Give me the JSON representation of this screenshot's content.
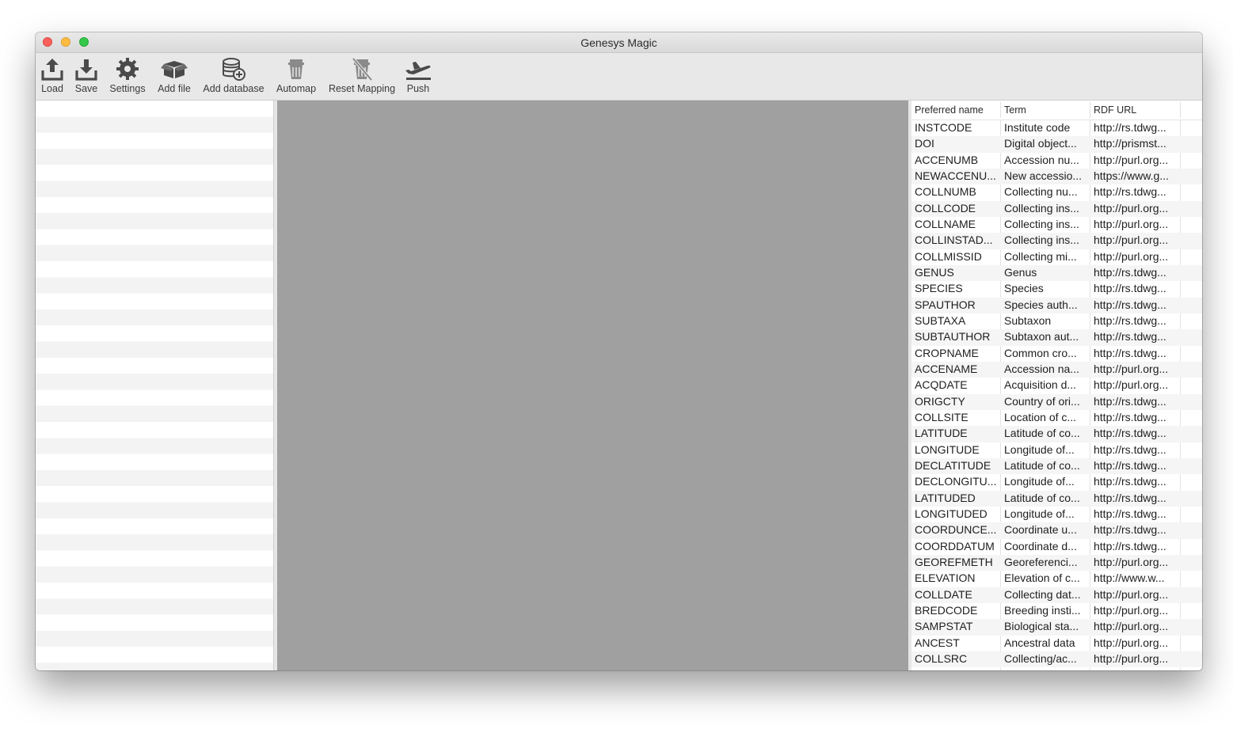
{
  "window": {
    "title": "Genesys Magic"
  },
  "toolbar": {
    "items": [
      {
        "label": "Load",
        "icon": "upload-icon"
      },
      {
        "label": "Save",
        "icon": "download-icon"
      },
      {
        "label": "Settings",
        "icon": "gear-icon"
      },
      {
        "label": "Add file",
        "icon": "open-box-icon"
      },
      {
        "label": "Add database",
        "icon": "database-add-icon"
      },
      {
        "label": "Automap",
        "icon": "trash-can-icon"
      },
      {
        "label": "Reset Mapping",
        "icon": "trash-crossed-icon"
      },
      {
        "label": "Push",
        "icon": "plane-takeoff-icon"
      }
    ]
  },
  "table": {
    "columns": [
      "Preferred name",
      "Term",
      "RDF URL"
    ],
    "rows": [
      [
        "INSTCODE",
        "Institute code",
        "http://rs.tdwg..."
      ],
      [
        "DOI",
        "Digital object...",
        "http://prismst..."
      ],
      [
        "ACCENUMB",
        "Accession nu...",
        "http://purl.org..."
      ],
      [
        "NEWACCENU...",
        "New accessio...",
        "https://www.g..."
      ],
      [
        "COLLNUMB",
        "Collecting nu...",
        "http://rs.tdwg..."
      ],
      [
        "COLLCODE",
        "Collecting ins...",
        "http://purl.org..."
      ],
      [
        "COLLNAME",
        "Collecting ins...",
        "http://purl.org..."
      ],
      [
        "COLLINSTAD...",
        "Collecting ins...",
        "http://purl.org..."
      ],
      [
        "COLLMISSID",
        "Collecting mi...",
        "http://purl.org..."
      ],
      [
        "GENUS",
        "Genus",
        "http://rs.tdwg..."
      ],
      [
        "SPECIES",
        "Species",
        "http://rs.tdwg..."
      ],
      [
        "SPAUTHOR",
        "Species auth...",
        "http://rs.tdwg..."
      ],
      [
        "SUBTAXA",
        "Subtaxon",
        "http://rs.tdwg..."
      ],
      [
        "SUBTAUTHOR",
        "Subtaxon aut...",
        "http://rs.tdwg..."
      ],
      [
        "CROPNAME",
        "Common cro...",
        "http://rs.tdwg..."
      ],
      [
        "ACCENAME",
        "Accession na...",
        "http://purl.org..."
      ],
      [
        "ACQDATE",
        "Acquisition d...",
        "http://purl.org..."
      ],
      [
        "ORIGCTY",
        "Country of ori...",
        "http://rs.tdwg..."
      ],
      [
        "COLLSITE",
        "Location of c...",
        "http://rs.tdwg..."
      ],
      [
        "LATITUDE",
        "Latitude of co...",
        "http://rs.tdwg..."
      ],
      [
        "LONGITUDE",
        "Longitude of...",
        "http://rs.tdwg..."
      ],
      [
        "DECLATITUDE",
        "Latitude of co...",
        "http://rs.tdwg..."
      ],
      [
        "DECLONGITU...",
        "Longitude of...",
        "http://rs.tdwg..."
      ],
      [
        "LATITUDED",
        "Latitude of co...",
        "http://rs.tdwg..."
      ],
      [
        "LONGITUDED",
        "Longitude of...",
        "http://rs.tdwg..."
      ],
      [
        "COORDUNCE...",
        "Coordinate u...",
        "http://rs.tdwg..."
      ],
      [
        "COORDDATUM",
        "Coordinate d...",
        "http://rs.tdwg..."
      ],
      [
        "GEOREFMETH",
        "Georeferenci...",
        "http://purl.org..."
      ],
      [
        "ELEVATION",
        "Elevation of c...",
        "http://www.w..."
      ],
      [
        "COLLDATE",
        "Collecting dat...",
        "http://purl.org..."
      ],
      [
        "BREDCODE",
        "Breeding insti...",
        "http://purl.org..."
      ],
      [
        "SAMPSTAT",
        "Biological sta...",
        "http://purl.org..."
      ],
      [
        "ANCEST",
        "Ancestral data",
        "http://purl.org..."
      ],
      [
        "COLLSRC",
        "Collecting/ac...",
        "http://purl.org..."
      ]
    ]
  }
}
